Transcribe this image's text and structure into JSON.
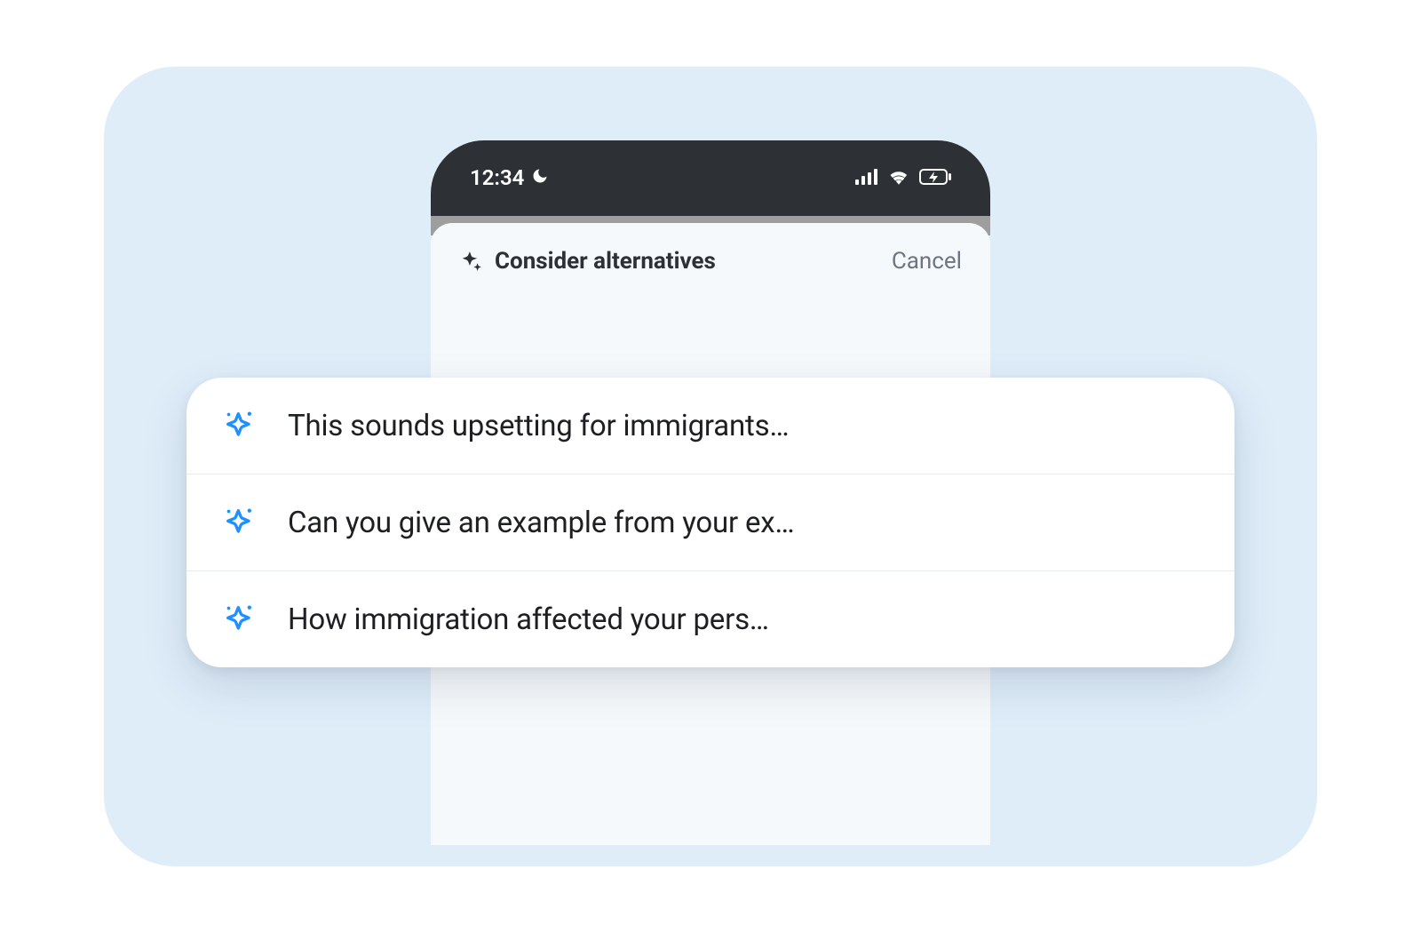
{
  "status_bar": {
    "time": "12:34"
  },
  "sheet": {
    "title": "Consider alternatives",
    "cancel_label": "Cancel"
  },
  "suggestions": [
    {
      "text": "This sounds upsetting for immigrants…"
    },
    {
      "text": "Can you give an example from your ex…"
    },
    {
      "text": "How immigration affected your pers…"
    }
  ],
  "colors": {
    "canvas_bg": "#dfedf9",
    "accent_blue": "#1e90ff",
    "text_primary": "#1d1f23",
    "text_muted": "#6d7580"
  }
}
